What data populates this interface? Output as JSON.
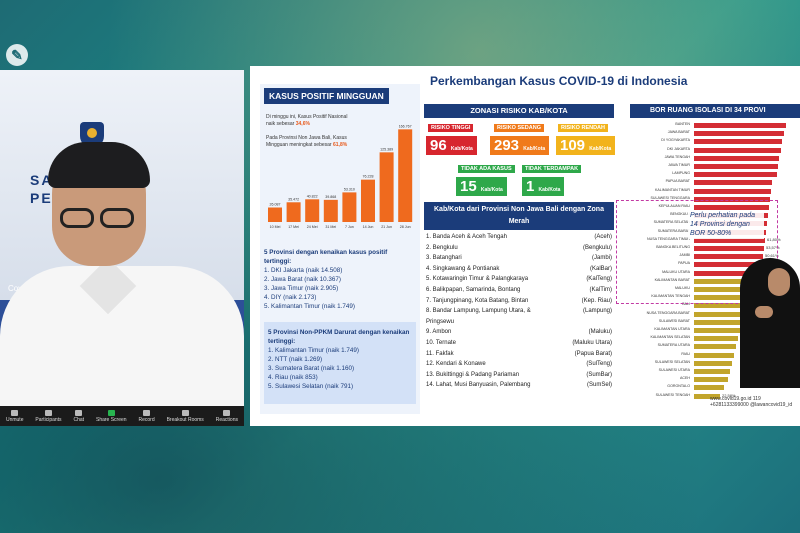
{
  "speaker": {
    "wall_line1": "SATGAS",
    "wall_line2": "PE",
    "watermark": "Covid19.go.id",
    "zoom_controls": [
      "Unmute",
      "Participants",
      "Chat",
      "Share Screen",
      "Record",
      "Breakout Rooms",
      "Reactions"
    ]
  },
  "slide": {
    "title": "Perkembangan Kasus COVID-19 di Indonesia",
    "weekly": {
      "heading": "KASUS POSITIF MINGGUAN",
      "note1_pre": "Di minggu ini, Kasus Positif Nasional naik sebesar",
      "note1_val": "34,6%",
      "note2_pre": "Pada Provinsi Non Jawa Bali, Kasus Mingguan meningkat sebesar",
      "note2_val": "61,8%",
      "provinces_heading": "5 Provinsi dengan kenaikan kasus positif tertinggi:",
      "provinces": [
        "1. DKI Jakarta (naik 14.508)",
        "2. Jawa Barat (naik 10.367)",
        "3. Jawa Timur (naik 2.905)",
        "4. DIY (naik 2.173)",
        "5. Kalimantan Timur (naik 1.749)"
      ],
      "nonppkm_heading": "5 Provinsi Non-PPKM Darurat dengan kenaikan tertinggi:",
      "nonppkm": [
        "1. Kalimantan Timur (naik 1.749)",
        "2. NTT (naik 1.269)",
        "3. Sumatera Barat (naik 1.160)",
        "4. Riau (naik 853)",
        "5. Sulawesi Selatan (naik 791)"
      ]
    },
    "zonasi": {
      "heading": "ZONASI RISIKO KAB/KOTA",
      "tinggi_label": "RISIKO TINGGI",
      "tinggi_val": "96",
      "sedang_label": "RISIKO SEDANG",
      "sedang_val": "293",
      "rendah_label": "RISIKO RENDAH",
      "rendah_val": "109",
      "tak_label": "TIDAK ADA KASUS",
      "tak_val": "15",
      "terdampak_label": "TIDAK TERDAMPAK",
      "terdampak_val": "1",
      "unit": "Kab/Kota"
    },
    "red_zone": {
      "heading": "Kab/Kota dari Provinsi Non Jawa Bali dengan Zona Merah",
      "rows": [
        [
          "1. Banda Aceh & Aceh Tengah",
          "(Aceh)"
        ],
        [
          "2. Bengkulu",
          "(Bengkulu)"
        ],
        [
          "3. Batanghari",
          "(Jambi)"
        ],
        [
          "4. Singkawang & Pontianak",
          "(KalBar)"
        ],
        [
          "5. Kotawaringin Timur & Palangkaraya",
          "(KalTeng)"
        ],
        [
          "6. Balikpapan, Samarinda, Bontang",
          "(KalTim)"
        ],
        [
          "7. Tanjungpinang, Kota Batang, Bintan",
          "(Kep. Riau)"
        ],
        [
          "8. Bandar Lampung, Lampung Utara, &",
          "(Lampung)"
        ],
        [
          "   Pringsewu",
          ""
        ],
        [
          "9. Ambon",
          "(Maluku)"
        ],
        [
          "10. Ternate",
          "(Maluku Utara)"
        ],
        [
          "11. Fakfak",
          "(Papua Barat)"
        ],
        [
          "12. Kendari & Konawe",
          "(SulTeng)"
        ],
        [
          "13. Bukittinggi & Padang Pariaman",
          "(SumBar)"
        ],
        [
          "14. Lahat, Musi Banyuasin, Palembang",
          "(SumSel)"
        ]
      ]
    },
    "bor": {
      "heading": "BOR RUANG ISOLASI DI 34 PROVI",
      "callout": "Perlu perhatian pada 14 Provinsi dengan BOR 50-80%",
      "provinces": [
        "BANTEN",
        "JAWA BARAT",
        "DI YOGYAKARTA",
        "DKI JAKARTA",
        "JAWA TENGAH",
        "JAWA TIMUR",
        "LAMPUNG",
        "PAPUA BARAT",
        "KALIMANTAN TIMUR",
        "SULAWESI TENGGARA",
        "KEPULAUAN RIAU",
        "BENGKULU",
        "SUMATERA SELATAN",
        "SUMATERA BARAT",
        "NUSA TENGGARA TIMUR",
        "BANGKA BELITUNG",
        "JAMBI",
        "PAPUA",
        "MALUKU UTARA",
        "KALIMANTAN BARAT",
        "MALUKU",
        "KALIMANTAN TENGAH",
        "BALI",
        "NUSA TENGGARA BARAT",
        "SULAWESI BARAT",
        "KALIMANTAN UTARA",
        "KALIMANTAN SELATAN",
        "SUMATERA UTARA",
        "RIAU",
        "SULAWESI SELATAN",
        "SULAWESI UTARA",
        "ACEH",
        "GORONTALO",
        "SULAWESI TENGAH"
      ],
      "values": [
        92,
        90,
        88,
        87,
        85,
        84,
        83,
        78,
        77,
        76,
        75,
        74,
        73,
        72,
        71,
        70,
        69,
        68,
        62,
        60,
        58,
        55,
        52,
        50,
        48,
        46,
        44,
        42,
        40,
        38,
        36,
        34,
        30,
        26
      ],
      "value_labels": [
        {
          "i": 14,
          "t": "61,80%"
        },
        {
          "i": 15,
          "t": "53,57%"
        },
        {
          "i": 16,
          "t": "50,61%"
        },
        {
          "i": 33,
          "t": "22,58%"
        }
      ]
    },
    "chart_data": {
      "type": "bar",
      "title": "KASUS POSITIF MINGGUAN",
      "categories": [
        "10 Mei",
        "17 Mei",
        "24 Mei",
        "31 Mei",
        "7 Jun",
        "14 Jun",
        "21 Jun",
        "28 Jun"
      ],
      "values": [
        26087,
        35472,
        40822,
        39868,
        53310,
        76228,
        125389,
        166767
      ],
      "labels": [
        "26.087",
        "35.472",
        "40.822",
        "39.868",
        "53.310",
        "76.228",
        "125.389",
        "166.767"
      ],
      "ylim": [
        0,
        180000
      ]
    },
    "footer": "www.covid19.go.id   119   +6281133399000   @lawancovid19_id"
  }
}
